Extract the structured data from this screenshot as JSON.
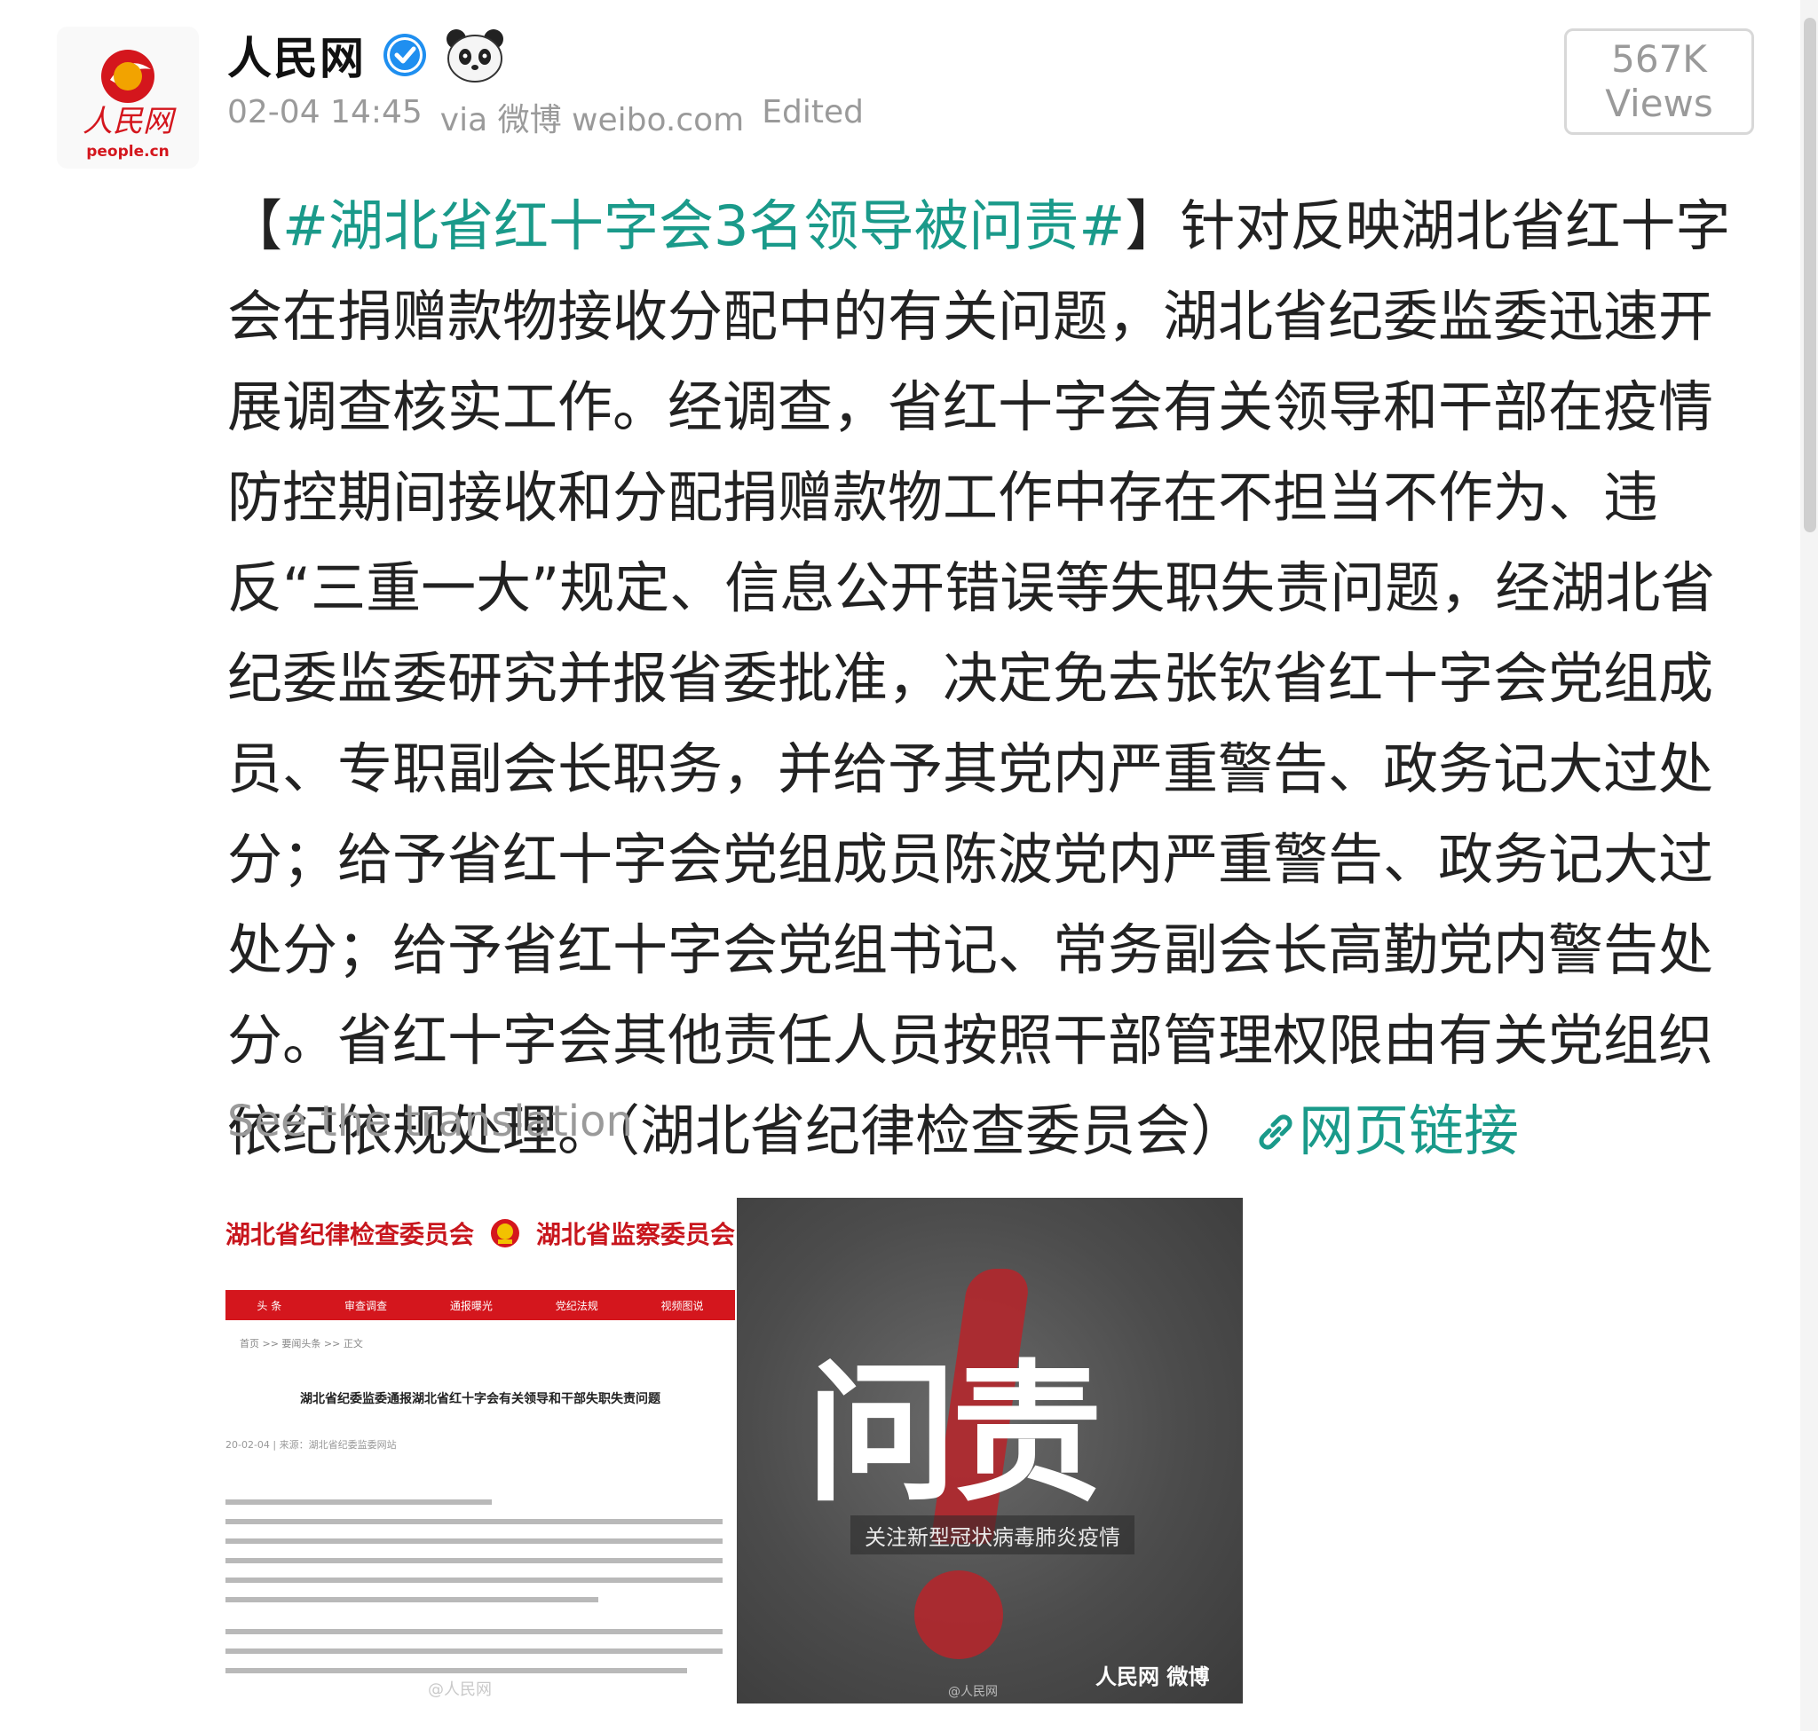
{
  "header": {
    "author": "人民网",
    "timestamp": "02-04 14:45",
    "via": "via 微博 weibo.com",
    "edited": "Edited",
    "views_count": "567K",
    "views_label": "Views",
    "avatar_logo_text": "人民网",
    "avatar_domain": "people.cn"
  },
  "post": {
    "hashtag": "#湖北省红十字会3名领导被问责#",
    "bracket_open": "【",
    "bracket_close": "】",
    "body": "针对反映湖北省红十字会在捐赠款物接收分配中的有关问题，湖北省纪委监委迅速开展调查核实工作。经调查，省红十字会有关领导和干部在疫情防控期间接收和分配捐赠款物工作中存在不担当不作为、违反“三重一大”规定、信息公开错误等失职失责问题，经湖北省纪委监委研究并报省委批准，决定免去张钦省红十字会党组成员、专职副会长职务，并给予其党内严重警告、政务记大过处分；给予省红十字会党组成员陈波党内严重警告、政务记大过处分；给予省红十字会党组书记、常务副会长高勤党内警告处分。省红十字会其他责任人员按照干部管理权限由有关党组织依纪依规处理。（湖北省纪律检查委员会）",
    "link_label": "网页链接",
    "translate": "See the translation"
  },
  "image1": {
    "site_title_left": "湖北省纪律检查委员会",
    "site_title_right": "湖北省监察委员会",
    "nav": [
      "头 条",
      "审查调查",
      "通报曝光",
      "党纪法规",
      "视频图说"
    ],
    "breadcrumb": "首页 >> 要闻头条 >> 正文",
    "article_title": "湖北省纪委监委通报湖北省红十字会有关领导和干部失职失责问题",
    "article_meta": "20-02-04 | 来源：湖北省纪委监委网站",
    "watermark": "@人民网"
  },
  "image2": {
    "headline": "问责",
    "caption": "关注新型冠状病毒肺炎疫情",
    "watermark": "@人民网",
    "brand": "人民网 微博"
  },
  "colors": {
    "hashtag": "#1a9a8a",
    "meta_gray": "#9a9a9a",
    "brand_red": "#d4161d",
    "verified_blue": "#1f8ff0"
  }
}
